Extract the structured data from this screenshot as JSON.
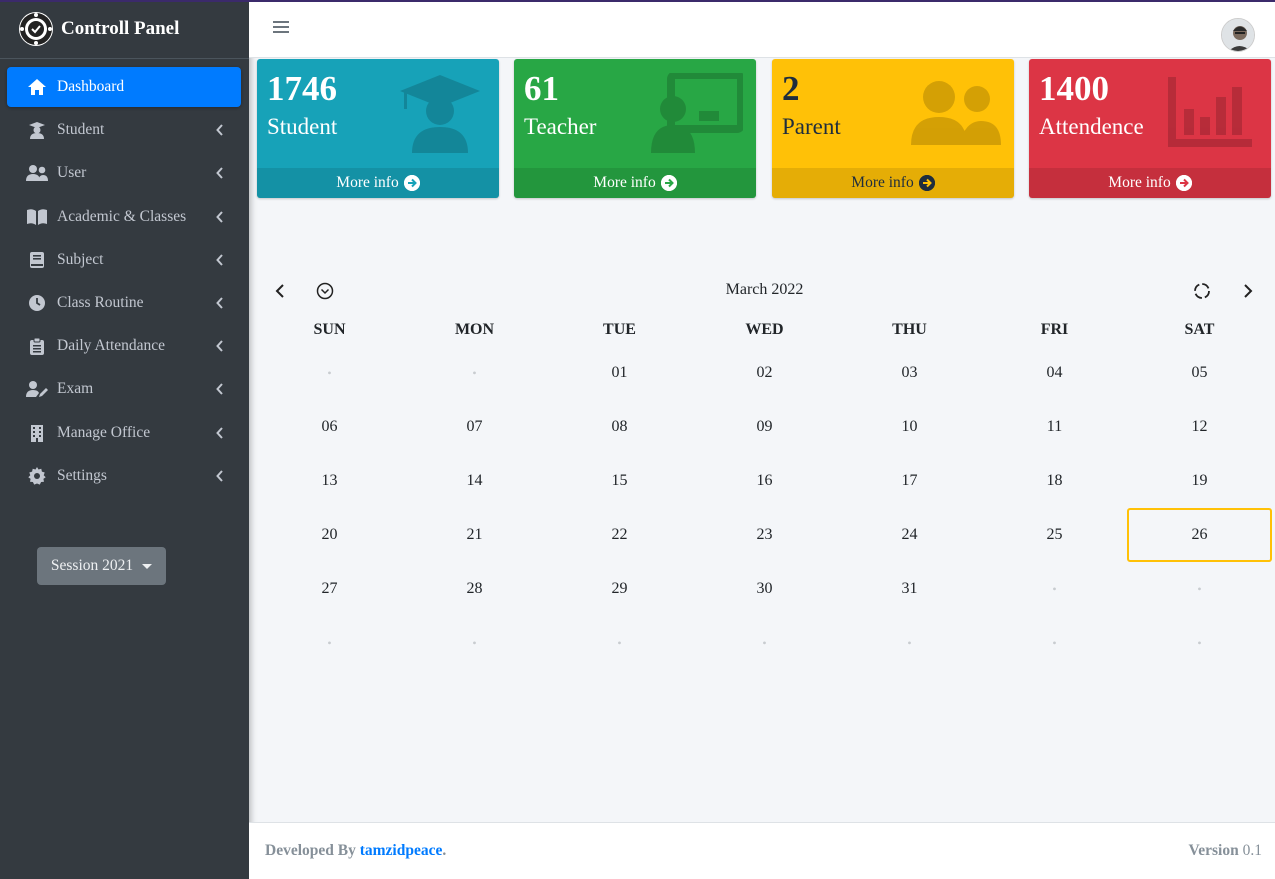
{
  "brand": {
    "title": "Controll Panel"
  },
  "sidebar": {
    "items": [
      {
        "label": "Dashboard",
        "icon": "home-icon",
        "active": true
      },
      {
        "label": "Student",
        "icon": "graduate-icon"
      },
      {
        "label": "User",
        "icon": "users-icon"
      },
      {
        "label": "Academic & Classes",
        "icon": "book-open-icon"
      },
      {
        "label": "Subject",
        "icon": "book-icon"
      },
      {
        "label": "Class Routine",
        "icon": "clock-icon"
      },
      {
        "label": "Daily Attendance",
        "icon": "clipboard-icon"
      },
      {
        "label": "Exam",
        "icon": "user-edit-icon"
      },
      {
        "label": "Manage Office",
        "icon": "building-icon"
      },
      {
        "label": "Settings",
        "icon": "gear-icon"
      }
    ],
    "session_label": "Session 2021"
  },
  "stats": [
    {
      "value": "1746",
      "label": "Student",
      "footer": "More info",
      "color": "#17a2b8",
      "icon": "graduate-icon"
    },
    {
      "value": "61",
      "label": "Teacher",
      "footer": "More info",
      "color": "#28a745",
      "icon": "teacher-board-icon"
    },
    {
      "value": "2",
      "label": "Parent",
      "footer": "More info",
      "color": "#ffc107",
      "icon": "users-icon"
    },
    {
      "value": "1400",
      "label": "Attendence",
      "footer": "More info",
      "color": "#dc3545",
      "icon": "bar-chart-icon"
    }
  ],
  "calendar": {
    "title": "March 2022",
    "weekdays": [
      "SUN",
      "MON",
      "TUE",
      "WED",
      "THU",
      "FRI",
      "SAT"
    ],
    "weeks": [
      [
        "•",
        "•",
        "01",
        "02",
        "03",
        "04",
        "05"
      ],
      [
        "06",
        "07",
        "08",
        "09",
        "10",
        "11",
        "12"
      ],
      [
        "13",
        "14",
        "15",
        "16",
        "17",
        "18",
        "19"
      ],
      [
        "20",
        "21",
        "22",
        "23",
        "24",
        "25",
        "26"
      ],
      [
        "27",
        "28",
        "29",
        "30",
        "31",
        "•",
        "•"
      ],
      [
        "•",
        "•",
        "•",
        "•",
        "•",
        "•",
        "•"
      ]
    ],
    "today": "26"
  },
  "footer": {
    "developed_by": "Developed By",
    "author": "tamzidpeace",
    "period": ".",
    "version_label": "Version",
    "version": "0.1"
  }
}
